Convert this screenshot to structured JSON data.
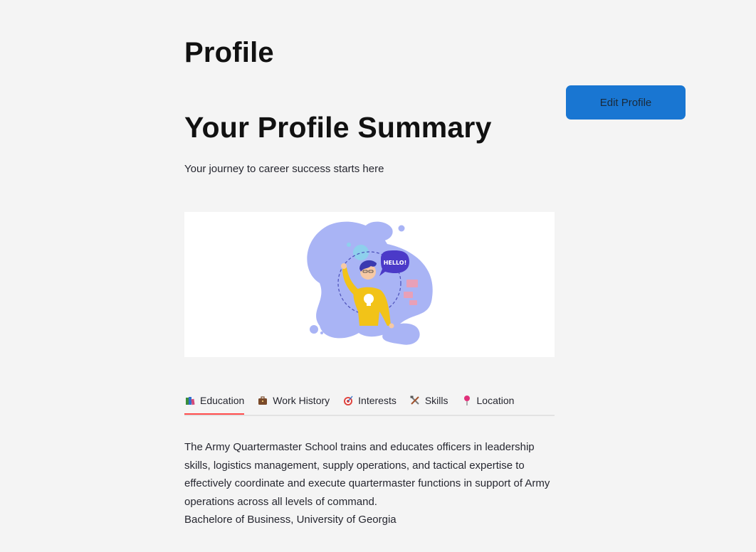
{
  "page": {
    "title": "Profile",
    "edit_button_label": "Edit Profile"
  },
  "summary": {
    "heading": "Your Profile Summary",
    "tagline": "Your journey to career success starts here"
  },
  "hero": {
    "illustration": "person-waving-hello",
    "speech_bubble_text": "HELLO!"
  },
  "tabs": [
    {
      "label": "Education",
      "icon": "books-icon",
      "active": true
    },
    {
      "label": "Work History",
      "icon": "briefcase-icon",
      "active": false
    },
    {
      "label": "Interests",
      "icon": "target-icon",
      "active": false
    },
    {
      "label": "Skills",
      "icon": "tools-icon",
      "active": false
    },
    {
      "label": "Location",
      "icon": "pin-icon",
      "active": false
    }
  ],
  "education": {
    "description": "The Army Quartermaster School trains and educates officers in leadership skills, logistics management, supply operations, and tactical expertise to effectively coordinate and execute quartermaster functions in support of Army operations across all levels of command.",
    "degree": "Bachelore of Business, University of Georgia"
  },
  "colors": {
    "background": "#f4f4f4",
    "primary_button": "#1976d2",
    "active_tab_underline": "#ff4b4b",
    "blob": "#a9b4f5"
  }
}
